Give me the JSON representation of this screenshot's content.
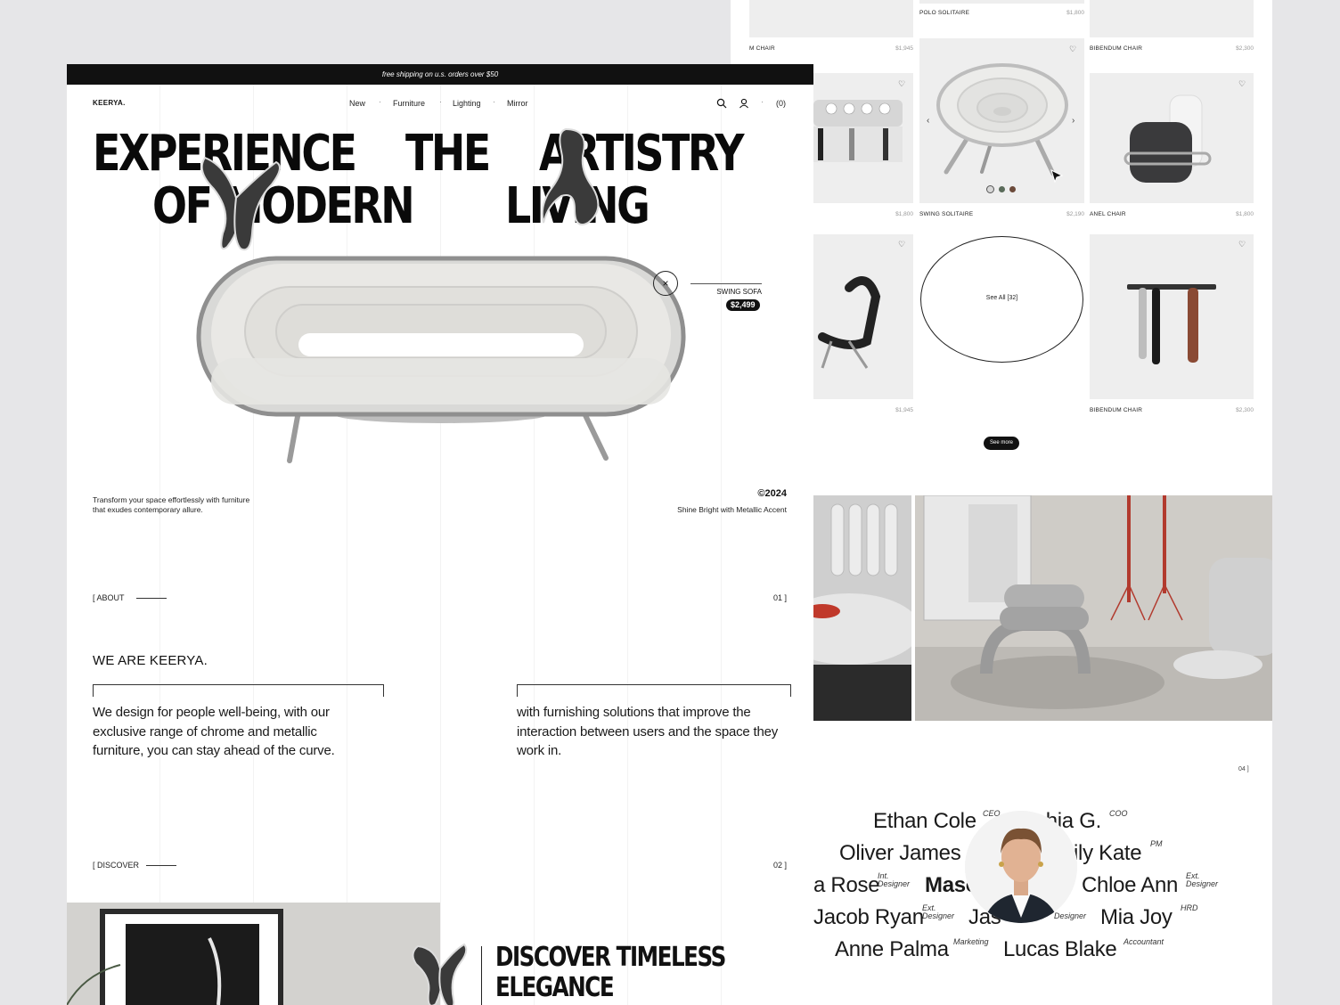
{
  "colors": {
    "background": "#e6e6e8",
    "ink": "#111111",
    "panel": "#eeeeee",
    "chrome": "#c9c9c9",
    "accent_red": "#c0392b"
  },
  "promo_bar": {
    "text": "free shipping on u.s. orders over $50"
  },
  "header": {
    "logo": "KEERYA.",
    "nav": [
      "New",
      "Furniture",
      "Lighting",
      "Mirror"
    ],
    "icons": [
      "search-icon",
      "user-icon",
      "cart-icon"
    ],
    "cart_count": "(0)"
  },
  "hero": {
    "line1": [
      "EXPERIENCE",
      "THE",
      "ARTISTRY"
    ],
    "line2": [
      "OF MODERN",
      "LIVING"
    ],
    "product_name": "SWING SOFA",
    "product_price": "$2,499",
    "tagline": "Transform your space effortlessly with furniture that exudes contemporary allure.",
    "year": "©2024",
    "year_sub": "Shine Bright with Metallic Accent"
  },
  "about": {
    "label": "[ ABOUT",
    "num": "01 ]",
    "title": "WE ARE KEERYA.",
    "para1": "We design for people well-being, with our exclusive range of chrome and metallic furniture, you can stay ahead of the curve.",
    "para2": "with furnishing solutions that improve the interaction between users and the space they work in."
  },
  "discover": {
    "label": "[ DISCOVER",
    "num": "02 ]",
    "title_line1": "DISCOVER TIMELESS",
    "title_line2": "ELEGANCE"
  },
  "grid": {
    "top_row": [
      {
        "name": "POLO SOLITAIRE",
        "price": "$1,800"
      }
    ],
    "row0": [
      {
        "name": "M CHAIR",
        "price": "$1,945"
      },
      {
        "name": "BIBENDUM CHAIR",
        "price": "$2,300"
      }
    ],
    "row1": [
      {
        "name": "",
        "price": "$1,800"
      },
      {
        "name": "SWING SOLITAIRE",
        "price": "$2,190"
      },
      {
        "name": "ANEL CHAIR",
        "price": "$1,800"
      }
    ],
    "row2": [
      {
        "name": "",
        "price": "$1,945"
      },
      {
        "name": "BIBENDUM CHAIR",
        "price": "$2,300"
      }
    ],
    "see_all": "See All [32]",
    "see_more": "See more",
    "swatches": [
      "#d8d8d8",
      "#5a6b5a",
      "#6b4a3a"
    ]
  },
  "team": {
    "num": "04 ]",
    "members": [
      {
        "name": "Ethan Cole",
        "role": "CEO"
      },
      {
        "name": "chia G.",
        "role": "COO"
      },
      {
        "name": "Oliver James",
        "role": ""
      },
      {
        "name": "ily Kate",
        "role": "PM"
      },
      {
        "name": "a Rose",
        "role": "Int. Designer"
      },
      {
        "name": "Mason Lee",
        "role": "Designer"
      },
      {
        "name": "Chloe Ann",
        "role": "Ext. Designer"
      },
      {
        "name": "Jacob Ryan",
        "role": "Ext. Designer"
      },
      {
        "name": "Jas",
        "role": "Designer"
      },
      {
        "name": "Mia Joy",
        "role": "HRD"
      },
      {
        "name": "Anne Palma",
        "role": "Marketing"
      },
      {
        "name": "Lucas Blake",
        "role": "Accountant"
      }
    ]
  }
}
